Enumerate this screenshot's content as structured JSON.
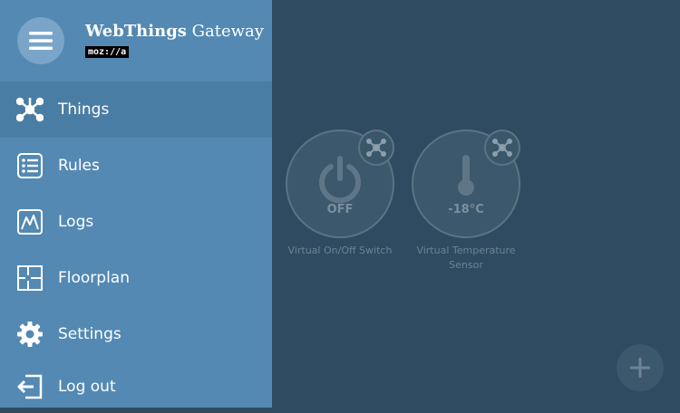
{
  "app": {
    "title_bold": "WebThings",
    "title_rest": " Gateway",
    "brand_logo": "moz://a"
  },
  "sidebar": {
    "items": [
      {
        "label": "Things",
        "icon": "things-icon",
        "active": true
      },
      {
        "label": "Rules",
        "icon": "rules-icon"
      },
      {
        "label": "Logs",
        "icon": "logs-icon"
      },
      {
        "label": "Floorplan",
        "icon": "floorplan-icon"
      },
      {
        "label": "Settings",
        "icon": "gear-icon"
      },
      {
        "label": "Log out",
        "icon": "logout-icon"
      }
    ]
  },
  "things": [
    {
      "name": "Virtual On/Off Switch",
      "state": "OFF",
      "icon": "power-icon"
    },
    {
      "name": "Virtual Temperature Sensor",
      "state": "-18°C",
      "icon": "thermometer-icon"
    }
  ],
  "colors": {
    "drawer": "#5389b3",
    "drawer_active": "#4a7da4",
    "background": "#2e4b61"
  }
}
